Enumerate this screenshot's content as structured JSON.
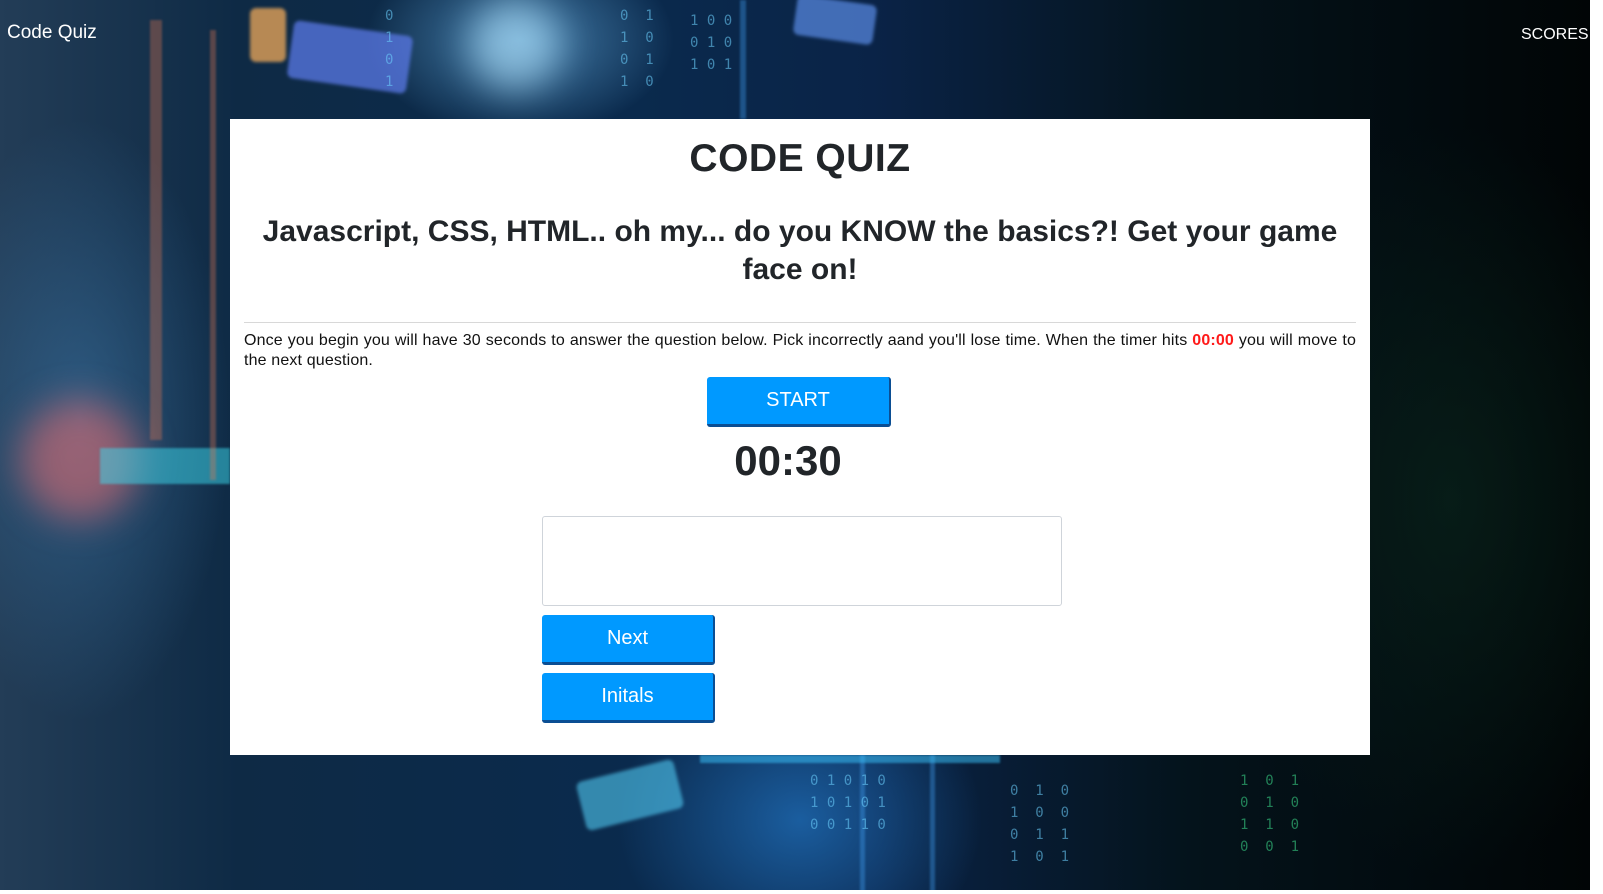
{
  "nav": {
    "brand": "Code Quiz",
    "scores_link": "SCORES"
  },
  "quiz": {
    "title": "CODE QUIZ",
    "subtitle": "Javascript, CSS, HTML.. oh my... do you KNOW the basics?! Get your game face on!",
    "instructions_before": "Once you begin you will have 30 seconds to answer the question below. Pick incorrectly aand you'll lose time. When the timer hits ",
    "instructions_timer": "00:00",
    "instructions_after": " you will move to the next question.",
    "start_label": "START",
    "timer": "00:30",
    "answer_value": "",
    "next_label": "Next",
    "initials_label": "Initals"
  },
  "colors": {
    "button": "#0099ff",
    "button_border": "#0b4e93",
    "timer_highlight": "#ff1a1a",
    "card": "#ffffff"
  }
}
